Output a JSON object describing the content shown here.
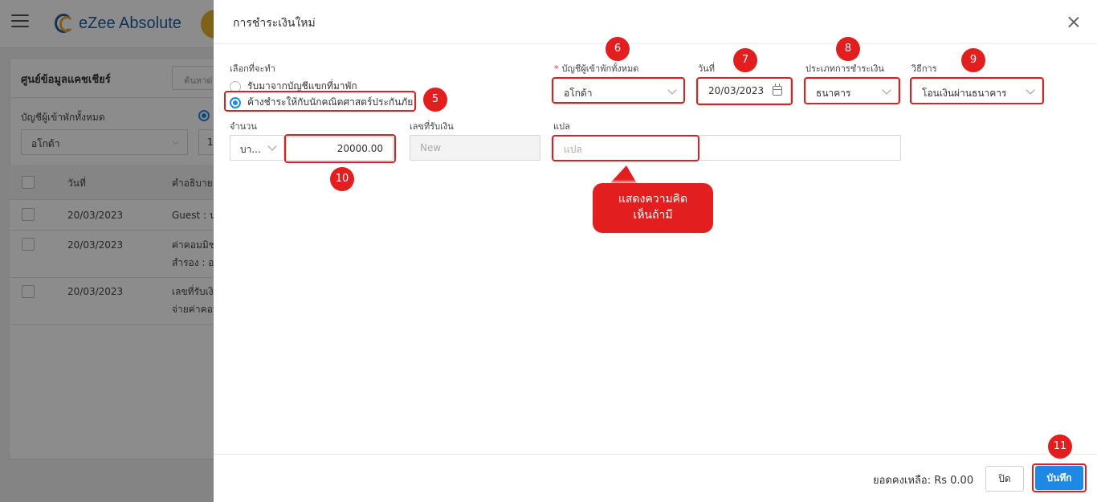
{
  "app": {
    "brand": "eZee Absolute"
  },
  "background": {
    "panel_title": "ศูนย์ข้อมูลแคชเชียร์",
    "search_placeholder": "ค้นหาด่วน",
    "filter_label": "บัญชีผู้เข้าพักทั้งหมด",
    "filter_value": "อโกด้า",
    "filter_value2": "1",
    "table": {
      "headers": [
        "วันที่",
        "คำอธิบาย"
      ],
      "rows": [
        {
          "date": "20/03/2023",
          "desc_line1": "Guest : น",
          "desc_line2": ""
        },
        {
          "date": "20/03/2023",
          "desc_line1": "ค่าคอมมิช",
          "desc_line2": "สำรอง : อ"
        },
        {
          "date": "20/03/2023",
          "desc_line1": "เลขที่รับเงิ",
          "desc_line2": "จ่ายค่าคอม"
        }
      ]
    }
  },
  "dialog": {
    "title": "การชำระเงินใหม่",
    "action_label": "เลือกที่จะทำ",
    "options": [
      {
        "label": "รับมาจากบัญชีแขกที่มาพัก",
        "selected": false
      },
      {
        "label": "ค้างชำระให้กับนักคณิตศาสตร์ประกันภัย",
        "selected": true
      }
    ],
    "account_label": "บัญชีผู้เข้าพักทั้งหมด",
    "account_value": "อโกด้า",
    "date_label": "วันที่",
    "date_value": "20/03/2023",
    "payment_type_label": "ประเภทการชำระเงิน",
    "payment_type_value": "ธนาคาร",
    "method_label": "วิธีการ",
    "method_value": "โอนเงินผ่านธนาคาร",
    "amount_label": "จำนวน",
    "currency_value": "บา...",
    "amount_value": "20000.00",
    "receipt_label": "เลขที่รับเงิน",
    "receipt_value": "New",
    "comment_label": "แปล",
    "comment_placeholder": "แปล",
    "balance_text": "ยอดคงเหลือ: Rs 0.00",
    "close_label": "ปิด",
    "save_label": "บันทึก"
  },
  "annotations": {
    "badges": [
      "5",
      "6",
      "7",
      "8",
      "9",
      "10",
      "11"
    ],
    "callout_line1": "แสดงความคิด",
    "callout_line2": "เห็นถ้ามี",
    "color": "#e31e1e"
  },
  "colors": {
    "accent": "#1e88e5",
    "annotation": "#e31e1e"
  }
}
